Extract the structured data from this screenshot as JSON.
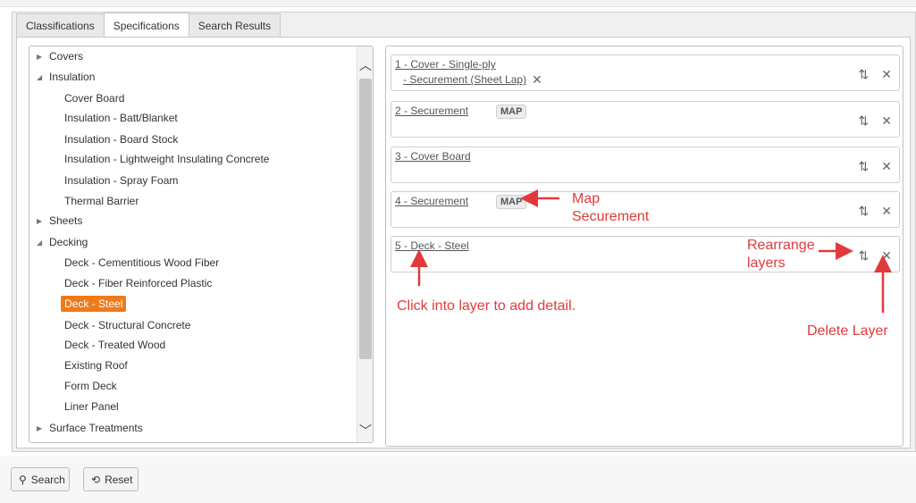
{
  "tabs": [
    {
      "label": "Classifications"
    },
    {
      "label": "Specifications"
    },
    {
      "label": "Search Results"
    }
  ],
  "tree": {
    "items": [
      {
        "label": "Covers"
      },
      {
        "label": "Insulation"
      },
      {
        "label": "Cover Board"
      },
      {
        "label": "Insulation - Batt/Blanket"
      },
      {
        "label": "Insulation - Board Stock"
      },
      {
        "label": "Insulation - Lightweight Insulating Concrete"
      },
      {
        "label": "Insulation - Spray Foam"
      },
      {
        "label": "Thermal Barrier"
      },
      {
        "label": "Sheets"
      },
      {
        "label": "Decking"
      },
      {
        "label": "Deck - Cementitious Wood Fiber"
      },
      {
        "label": "Deck - Fiber Reinforced Plastic"
      },
      {
        "label": "Deck - Steel"
      },
      {
        "label": "Deck - Structural Concrete"
      },
      {
        "label": "Deck - Treated Wood"
      },
      {
        "label": "Existing Roof"
      },
      {
        "label": "Form Deck"
      },
      {
        "label": "Liner Panel"
      },
      {
        "label": "Surface Treatments"
      }
    ],
    "selected_label": "Deck - Steel"
  },
  "layers": [
    {
      "label": "1 - Cover - Single-ply",
      "sub": "- Securement (Sheet Lap)"
    },
    {
      "label": "2 - Securement",
      "badge": "MAP"
    },
    {
      "label": "3 - Cover Board"
    },
    {
      "label": "4 - Securement",
      "badge": "MAP"
    },
    {
      "label": "5 - Deck - Steel"
    }
  ],
  "icons": {
    "rearrange": "⇅",
    "delete": "✕",
    "caret_collapsed": "▶",
    "caret_expanded": "◢",
    "scroll_up": "︿",
    "scroll_down": "﹀",
    "search": "⚲",
    "reset": "⟲"
  },
  "annotations": {
    "map_securement_line1": "Map",
    "map_securement_line2": "Securement",
    "rearrange_line1": "Rearrange",
    "rearrange_line2": "layers",
    "click_into_layer": "Click into layer to add detail.",
    "delete_layer": "Delete Layer"
  },
  "buttons": {
    "search": "Search",
    "reset": "Reset"
  },
  "colors": {
    "selected": "#ef7a1a",
    "annotation": "#e23a3a"
  }
}
